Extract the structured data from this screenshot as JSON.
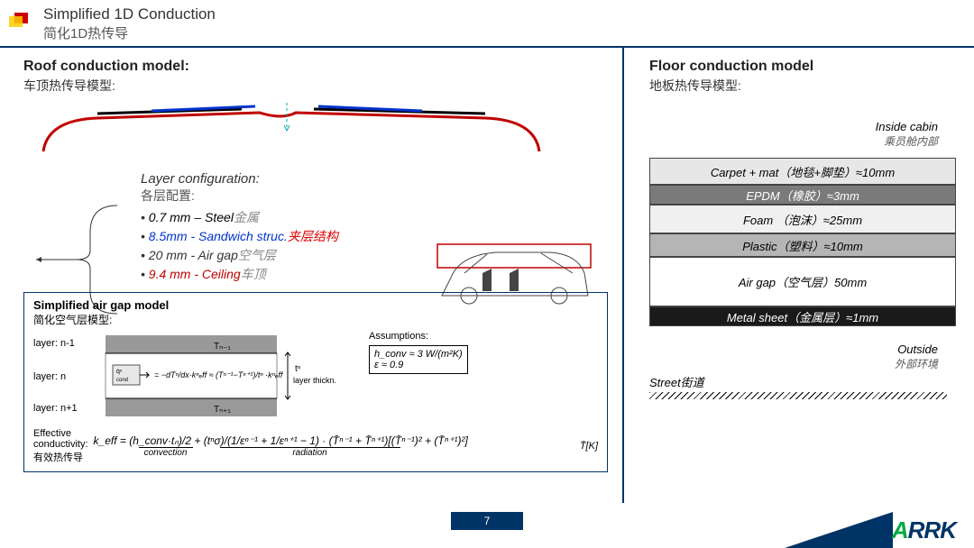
{
  "header": {
    "title_en": "Simplified 1D Conduction",
    "title_cn": "简化1D热传导"
  },
  "roof": {
    "title": "Roof conduction model:",
    "subtitle": "车顶热传导模型:",
    "layer_conf_title": "Layer configuration:",
    "layer_conf_sub": "各层配置:",
    "layers": {
      "steel": "0.7 mm – Steel",
      "steel_cn": "金属",
      "sandwich": "8.5mm - Sandwich struc.",
      "sandwich_cn": "夹层结构",
      "airgap": "20 mm - Air gap",
      "airgap_cn": "空气层",
      "ceiling": "9.4 mm - Ceiling",
      "ceiling_cn": "车顶"
    }
  },
  "airgap_model": {
    "title": "Simplified air gap model",
    "subtitle": "简化空气层模型:",
    "layer_nm1": "layer: n-1",
    "layer_n": "layer: n",
    "layer_np1": "layer: n+1",
    "T_nm1": "Tₙ₋₁",
    "T_np1": "Tₙ₊₁",
    "q_eq": "q̇ⁿ_cond = − dTⁿ/dx · kⁿ_eff ≈ (Tⁿ⁻¹ − Tⁿ⁺¹)/tⁿ · kⁿ_eff",
    "thickness": "tⁿ\nlayer thickn.",
    "assumptions": "Assumptions:",
    "h_conv": "h_conv ≈ 3 W/(m²K)",
    "eps": "ε ≈ 0.9",
    "eff_label": "Effective\nconductivity:\n有效热传导",
    "keff": "k_eff = (h_conv·tₙ)/2 + (tⁿσ)/(1/εⁿ⁻¹ + 1/εⁿ⁺¹ − 1) · (T̄ⁿ⁻¹ + T̄ⁿ⁺¹)[(T̄ⁿ⁻¹)² + (T̄ⁿ⁺¹)²]",
    "conv_label": "convection",
    "rad_label": "radiation",
    "T_axis": "T̄[K]"
  },
  "floor": {
    "title": "Floor conduction model",
    "subtitle": "地板热传导模型:",
    "inside": "Inside cabin",
    "inside_cn": "乘员舱内部",
    "carpet": "Carpet + mat（地毯+脚垫）≈10mm",
    "epdm": "EPDM（橡胶）≈3mm",
    "foam": "Foam （泡沫）≈25mm",
    "plastic": "Plastic（塑料）≈10mm",
    "airgap": "Air gap（空气层）50mm",
    "metal": "Metal sheet（金属层）≈1mm",
    "outside": "Outside",
    "outside_cn": "外部环境",
    "street": "Street街道"
  },
  "page": "7",
  "brand": "ARRK",
  "chart_data": {
    "roof_layers": [
      {
        "name": "Steel",
        "thickness_mm": 0.7
      },
      {
        "name": "Sandwich struc.",
        "thickness_mm": 8.5
      },
      {
        "name": "Air gap",
        "thickness_mm": 20
      },
      {
        "name": "Ceiling",
        "thickness_mm": 9.4
      }
    ],
    "floor_layers": [
      {
        "name": "Carpet + mat",
        "thickness_mm": 10
      },
      {
        "name": "EPDM",
        "thickness_mm": 3
      },
      {
        "name": "Foam",
        "thickness_mm": 25
      },
      {
        "name": "Plastic",
        "thickness_mm": 10
      },
      {
        "name": "Air gap",
        "thickness_mm": 50
      },
      {
        "name": "Metal sheet",
        "thickness_mm": 1
      }
    ],
    "assumptions": {
      "h_conv_W_m2K": 3,
      "emissivity": 0.9
    }
  }
}
